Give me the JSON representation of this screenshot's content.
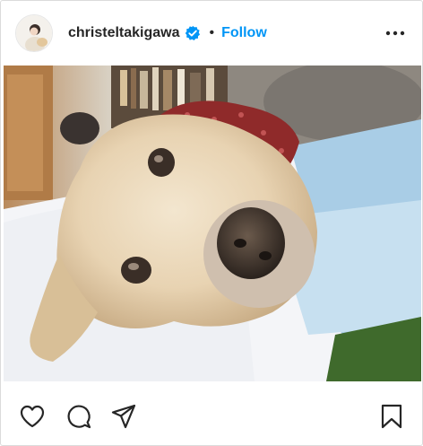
{
  "post": {
    "username": "christeltakigawa",
    "follow_label": "Follow",
    "separator": "•",
    "verified": true
  },
  "icons": {
    "avatar": "avatar",
    "verified": "verified-badge-icon",
    "more": "more-options-icon",
    "like": "heart-icon",
    "comment": "comment-icon",
    "share": "share-icon",
    "save": "bookmark-icon"
  },
  "colors": {
    "accent": "#0095f6",
    "verified": "#0095f6",
    "text": "#262626",
    "border": "#dbdbdb"
  }
}
